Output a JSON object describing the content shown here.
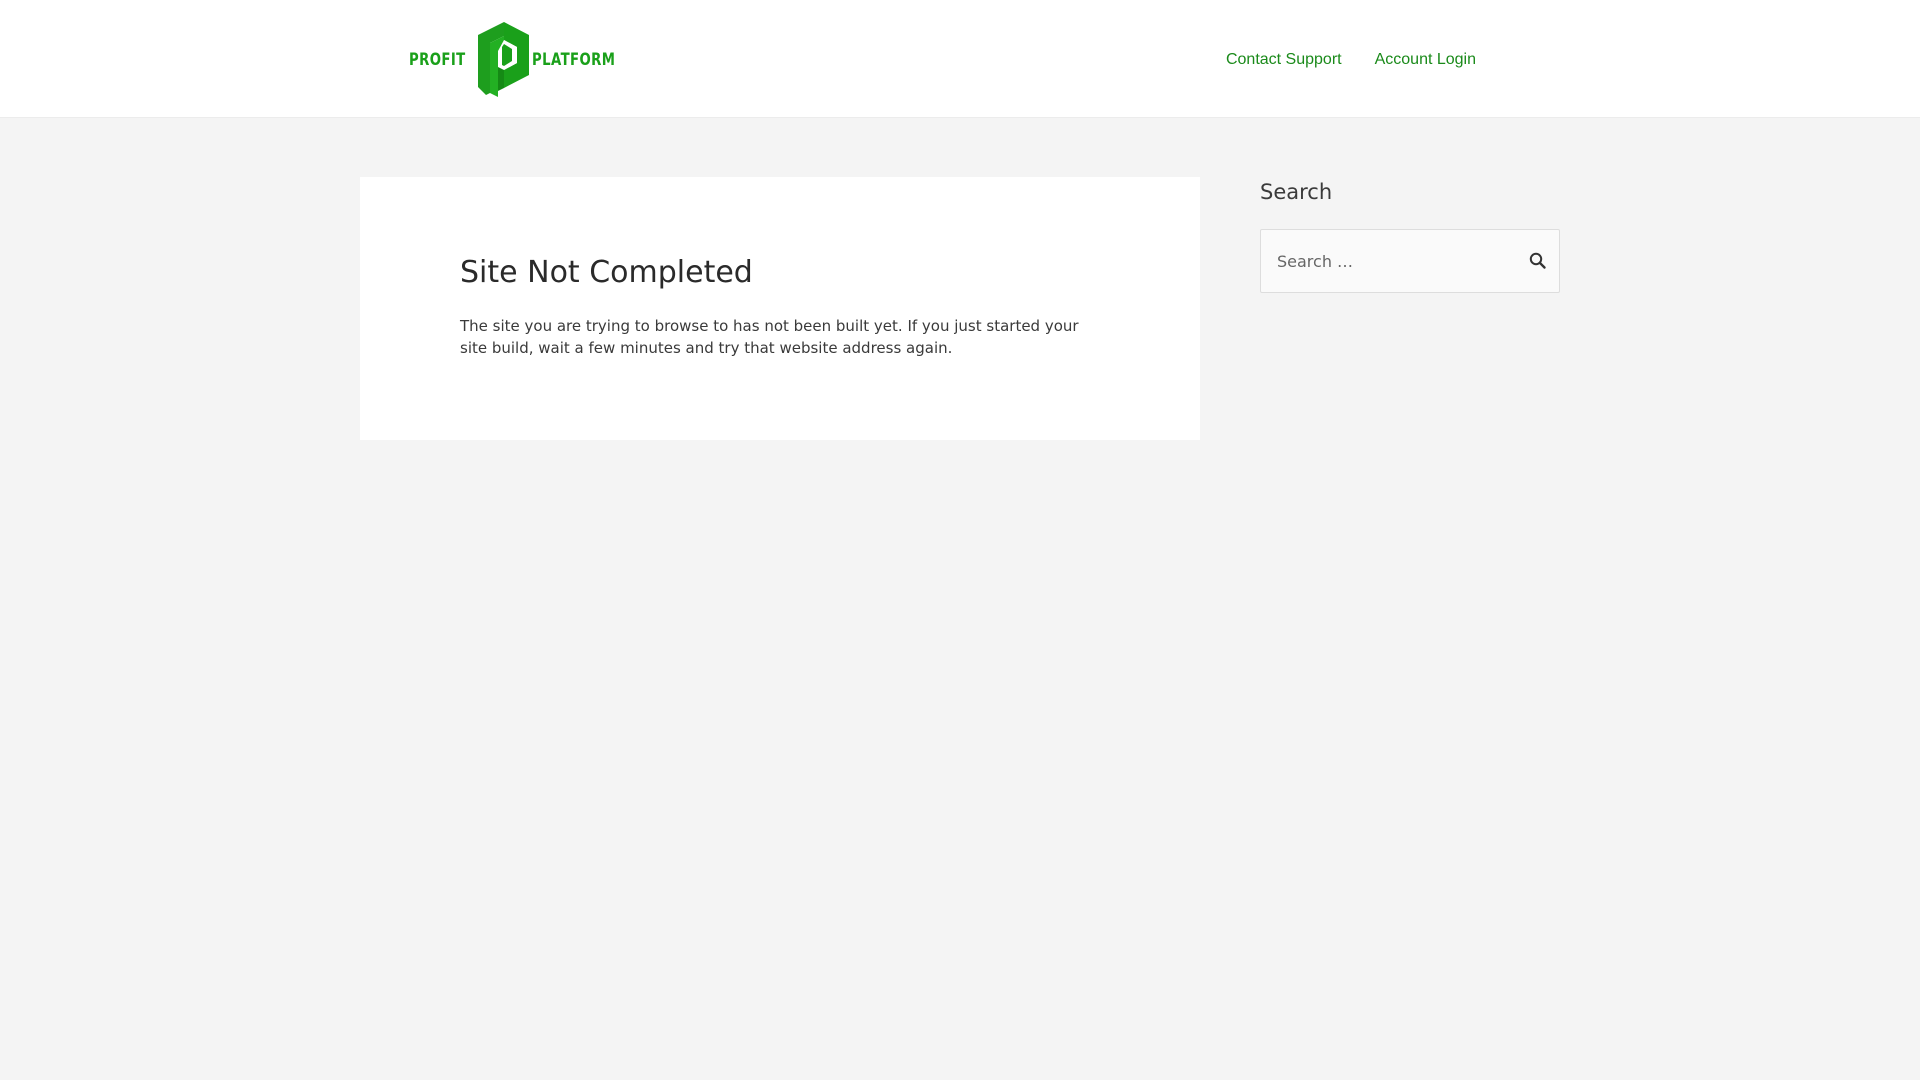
{
  "header": {
    "logo": {
      "word_left": "PROFIT",
      "word_right": "PLATFORM",
      "icon": "profit-platform-p-logo",
      "color": "#1aa01a"
    },
    "nav": [
      {
        "label": "Contact Support"
      },
      {
        "label": "Account Login"
      }
    ],
    "link_color": "#1a8a1a"
  },
  "main": {
    "title": "Site Not Completed",
    "body": "The site you are trying to browse to has not been built yet. If you just started your site build, wait a few minutes and try that website address again."
  },
  "sidebar": {
    "widget_title": "Search",
    "search": {
      "placeholder": "Search …",
      "value": "",
      "icon": "search-icon"
    }
  },
  "colors": {
    "page_background": "#f4f4f4",
    "card_background": "#ffffff",
    "brand_green": "#1aa01a"
  }
}
